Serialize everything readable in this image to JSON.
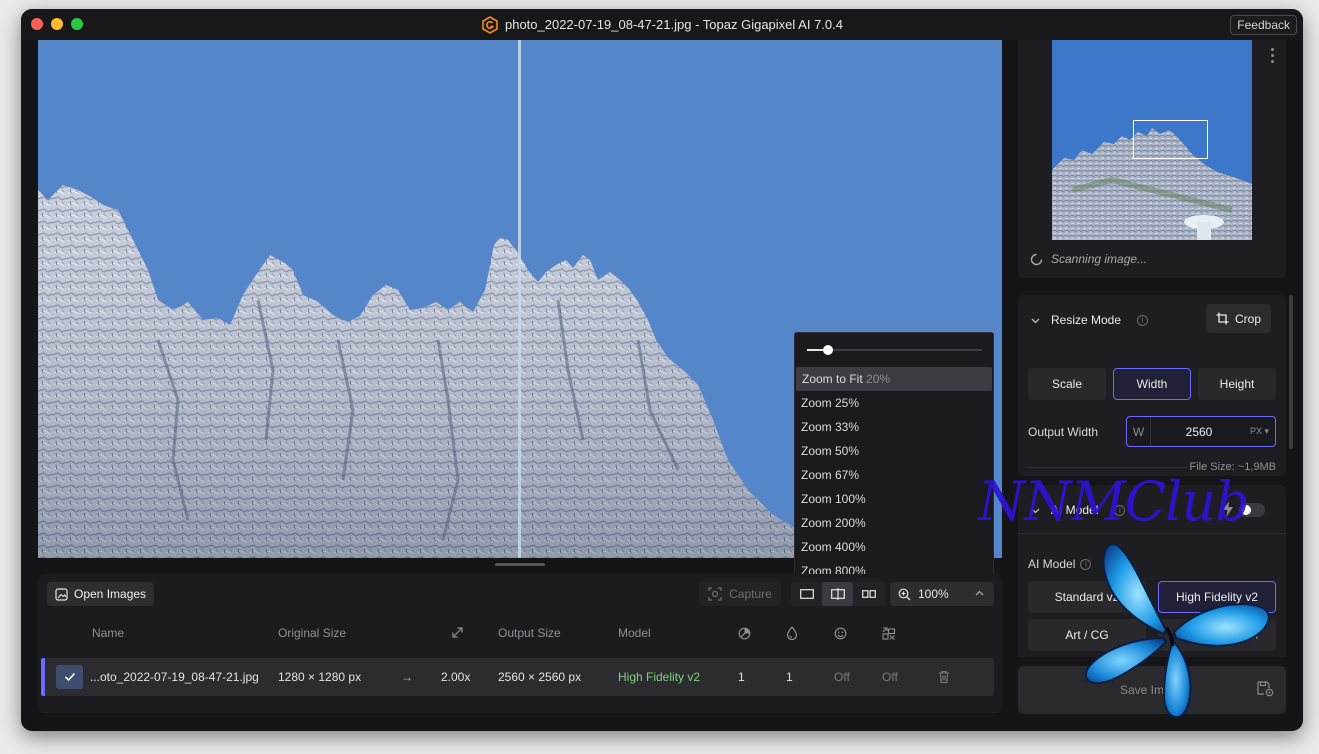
{
  "window": {
    "title": "photo_2022-07-19_08-47-21.jpg - Topaz Gigapixel AI 7.0.4",
    "feedback_label": "Feedback"
  },
  "zoom_menu": {
    "items": [
      {
        "label": "Zoom to Fit",
        "note": "20%"
      },
      {
        "label": "Zoom 25%"
      },
      {
        "label": "Zoom 33%"
      },
      {
        "label": "Zoom 50%"
      },
      {
        "label": "Zoom 67%"
      },
      {
        "label": "Zoom 100%"
      },
      {
        "label": "Zoom 200%"
      },
      {
        "label": "Zoom 400%"
      },
      {
        "label": "Zoom 800%"
      }
    ]
  },
  "toolbar": {
    "open_images_label": "Open Images",
    "capture_label": "Capture",
    "zoom_value": "100%"
  },
  "table": {
    "headers": {
      "name": "Name",
      "original_size": "Original Size",
      "output_size": "Output Size",
      "model": "Model"
    },
    "rows": [
      {
        "name": "...oto_2022-07-19_08-47-21.jpg",
        "original_size": "1280 × 1280 px",
        "arrow": "→",
        "scale": "2.00x",
        "output_size": "2560 × 2560 px",
        "model": "High Fidelity v2",
        "denoise": "1",
        "sharpen": "1",
        "face": "Off",
        "compression": "Off"
      }
    ]
  },
  "navigator": {
    "status": "Scanning image..."
  },
  "resize": {
    "title": "Resize Mode",
    "crop_label": "Crop",
    "modes": [
      "Scale",
      "Width",
      "Height"
    ],
    "selected_mode": "Width",
    "output_width_label": "Output Width",
    "dimension_letter": "W",
    "output_width_value": "2560",
    "unit": "PX",
    "file_size": "File Size: ~1,9MB"
  },
  "ai_model": {
    "title": "AI Model",
    "sub_label": "AI Model",
    "models": [
      "Standard v2",
      "High Fidelity v2",
      "Art / CG",
      "Low Resolution"
    ],
    "selected_model": "High Fidelity v2"
  },
  "save": {
    "label": "Save Image"
  },
  "watermark": {
    "text": "NNMClub"
  },
  "colors": {
    "accent": "#6b6bff",
    "model_green": "#7fd47a",
    "sky": "#5586c9"
  }
}
